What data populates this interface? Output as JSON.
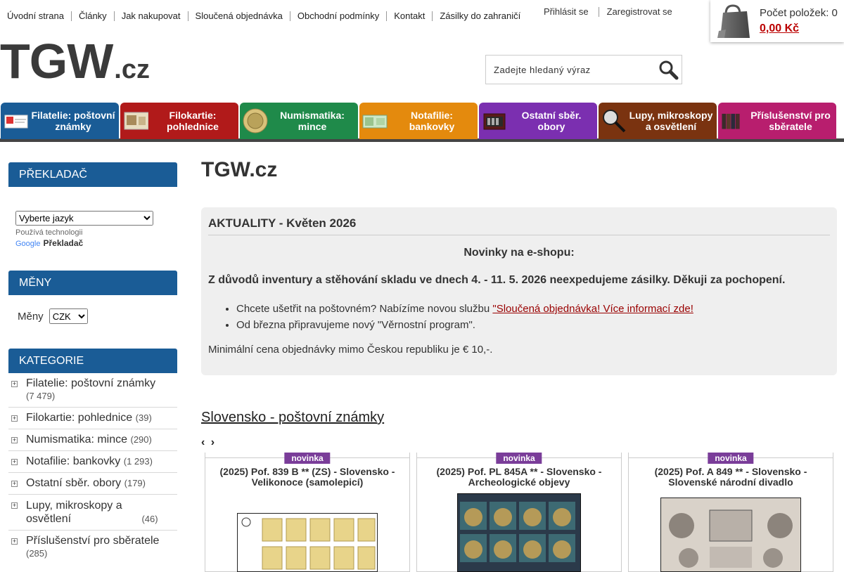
{
  "top_nav": [
    "Úvodní strana",
    "Články",
    "Jak nakupovat",
    "Sloučená objednávka",
    "Obchodní podmínky",
    "Kontakt",
    "Zásilky do zahraničí"
  ],
  "account": {
    "login": "Přihlásit se",
    "register": "Zaregistrovat se"
  },
  "cart": {
    "count_label": "Počet položek: 0",
    "total": "0,00 Kč"
  },
  "logo": {
    "main": "TGW",
    "suffix": ".cz"
  },
  "search": {
    "placeholder": "Zadejte hledaný výraz"
  },
  "tabs": [
    {
      "label": "Filatelie: poštovní známky",
      "color": "#1a5c96"
    },
    {
      "label": "Filokartie: pohlednice",
      "color": "#b11a1a"
    },
    {
      "label": "Numismatika: mince",
      "color": "#1f8a4a"
    },
    {
      "label": "Notafilie: bankovky",
      "color": "#e48a0d"
    },
    {
      "label": "Ostatní sběr. obory",
      "color": "#7b2fb0"
    },
    {
      "label": "Lupy, mikroskopy a osvětlení",
      "color": "#7a3310"
    },
    {
      "label": "Příslušenství pro sběratele",
      "color": "#b81e6e"
    }
  ],
  "sidebar": {
    "translator": {
      "title": "PŘEKLADAČ",
      "select_value": "Vyberte jazyk",
      "powered": "Používá technologii",
      "google": "Google",
      "product": "Překladač"
    },
    "currency": {
      "title": "MĚNY",
      "label": "Měny",
      "value": "CZK"
    },
    "categories": {
      "title": "KATEGORIE",
      "items": [
        {
          "name": "Filatelie: poštovní známky",
          "count": "(7 479)"
        },
        {
          "name": "Filokartie: pohlednice",
          "count": "(39)"
        },
        {
          "name": "Numismatika: mince",
          "count": "(290)"
        },
        {
          "name": "Notafilie: bankovky",
          "count": "(1 293)"
        },
        {
          "name": "Ostatní sběr. obory",
          "count": "(179)"
        },
        {
          "name": "Lupy, mikroskopy a osvětlení",
          "count": "(46)"
        },
        {
          "name": "Příslušenství pro sběratele",
          "count": "(285)"
        }
      ]
    }
  },
  "main": {
    "title": "TGW.cz",
    "news": {
      "heading": "AKTUALITY - Květen 2026",
      "subheading": "Novinky na e-shopu:",
      "warning": "Z důvodů inventury a stěhování skladu ve dnech 4. - 11. 5. 2026 neexpedujeme zásilky. Děkuji za pochopení.",
      "bullet1_text": "Chcete ušetřit na poštovném? Nabízíme novou službu ",
      "bullet1_link": "\"Sloučená objednávka! Více informací zde!",
      "bullet2": "Od března připravujeme nový \"Věrnostní program\".",
      "min_price": "Minimální cena objednávky mimo Českou republiku je € 10,-."
    },
    "section_link": "Slovensko - poštovní známky",
    "arrows": "‹ ›",
    "products": [
      {
        "badge": "novinka",
        "title": "(2025) Pof. 839 B ** (ZS) - Slovensko - Velikonoce (samolepicí)"
      },
      {
        "badge": "novinka",
        "title": "(2025) Pof. PL 845A ** - Slovensko - Archeologické objevy"
      },
      {
        "badge": "novinka",
        "title": "(2025) Pof. A 849 ** - Slovensko - Slovenské národní divadlo"
      }
    ]
  }
}
